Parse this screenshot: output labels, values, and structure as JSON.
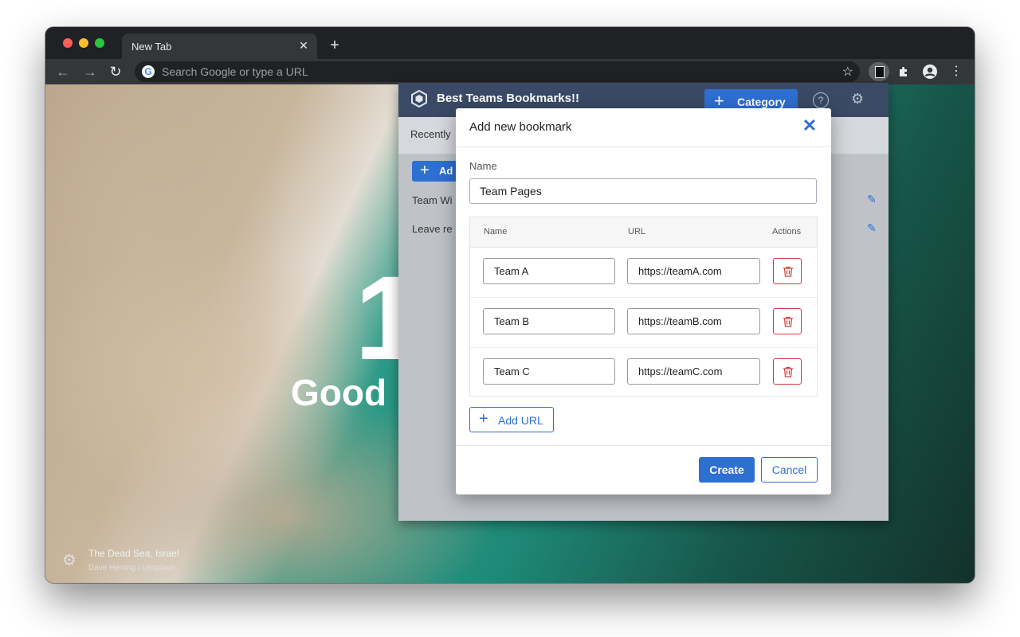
{
  "browser": {
    "tab_title": "New Tab",
    "tab_close": "✕",
    "new_tab": "+",
    "back": "←",
    "forward": "→",
    "reload": "↻",
    "omnibox_placeholder": "Search Google or type a URL",
    "google_letter": "G",
    "star": "☆",
    "menu": "⋮"
  },
  "background": {
    "time_partial": "1",
    "greeting_partial": "Good",
    "photo_title": "The Dead Sea, Israel",
    "photo_credit": "Dave Herring / Unsplash",
    "settings_icon": "⚙"
  },
  "popup": {
    "title": "Best Teams Bookmarks!!",
    "category_button": "Category",
    "plus": "+",
    "help": "?",
    "settings": "⚙",
    "recent_tab_partial": "Recently",
    "add_button_partial": "Ad",
    "rows": [
      "Team Wi",
      "Leave re"
    ],
    "edit_icon": "✎"
  },
  "modal": {
    "title": "Add new bookmark",
    "close": "✕",
    "name_label": "Name",
    "name_value": "Team Pages",
    "columns": {
      "name": "Name",
      "url": "URL",
      "actions": "Actions"
    },
    "urls": [
      {
        "name": "Team A",
        "url": "https://teamA.com"
      },
      {
        "name": "Team B",
        "url": "https://teamB.com"
      },
      {
        "name": "Team C",
        "url": "https://teamC.com"
      }
    ],
    "add_url": "Add URL",
    "create": "Create",
    "cancel": "Cancel"
  },
  "colors": {
    "accent": "#2e6fd2",
    "popup_header": "#3a4a66",
    "danger": "#d23b3b"
  }
}
